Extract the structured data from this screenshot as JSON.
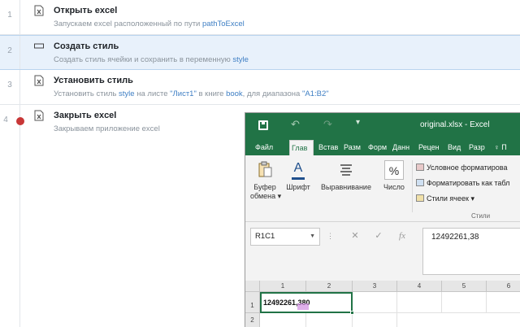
{
  "steps": [
    {
      "num": "1",
      "icon": "excel-file-icon",
      "title": "Открыть excel",
      "desc_parts": [
        {
          "text": "Запускаем excel расположенный по пути ",
          "hl": false
        },
        {
          "text": "pathToExcel",
          "hl": true
        }
      ]
    },
    {
      "num": "2",
      "icon": "rectangle-icon",
      "title": "Создать стиль",
      "selected": true,
      "desc_parts": [
        {
          "text": "Создать стиль ячейки и сохранить в переменную ",
          "hl": false
        },
        {
          "text": "style",
          "hl": true
        }
      ]
    },
    {
      "num": "3",
      "icon": "excel-file-icon",
      "title": "Установить стиль",
      "desc_parts": [
        {
          "text": "Установить стиль ",
          "hl": false
        },
        {
          "text": "style",
          "hl": true
        },
        {
          "text": " на листе ",
          "hl": false
        },
        {
          "text": "\"Лист1\"",
          "hl": true
        },
        {
          "text": " в книге ",
          "hl": false
        },
        {
          "text": "book",
          "hl": true
        },
        {
          "text": ", для диапазона ",
          "hl": false
        },
        {
          "text": "\"A1:B2\"",
          "hl": true
        }
      ]
    },
    {
      "num": "4",
      "icon": "excel-file-icon",
      "title": "Закрыть excel",
      "breakpoint": true,
      "desc_parts": [
        {
          "text": "Закрываем приложение excel",
          "hl": false
        }
      ]
    }
  ],
  "excel": {
    "window_title": "original.xlsx - Excel",
    "tabs": [
      "Файл",
      "Глав",
      "Встав",
      "Разм",
      "Форм",
      "Данн",
      "Рецен",
      "Вид",
      "Разр",
      "♀ П"
    ],
    "active_tab": 1,
    "ribbon": {
      "clipboard_label1": "Буфер",
      "clipboard_label2": "обмена ▾",
      "font_label": "Шрифт",
      "font_icon_letter": "A",
      "alignment_label": "Выравнивание",
      "number_label": "Число",
      "number_icon": "%",
      "conditional_formatting": "Условное форматирова",
      "format_as_table": "Форматировать как табл",
      "cell_styles": "Стили ячеек ▾",
      "styles_group_label": "Стили"
    },
    "name_box": "R1C1",
    "formula_value": "12492261,38",
    "formula_icons": {
      "cancel": "✕",
      "enter": "✓",
      "function": "fx"
    },
    "columns": [
      "1",
      "2",
      "3",
      "4",
      "5",
      "6"
    ],
    "rows": [
      "1",
      "2"
    ],
    "cell_r1c1": "12492261,380"
  },
  "colors": {
    "excel_green": "#217346",
    "breakpoint_red": "#c83737",
    "highlight_blue": "#3f7fc4"
  }
}
